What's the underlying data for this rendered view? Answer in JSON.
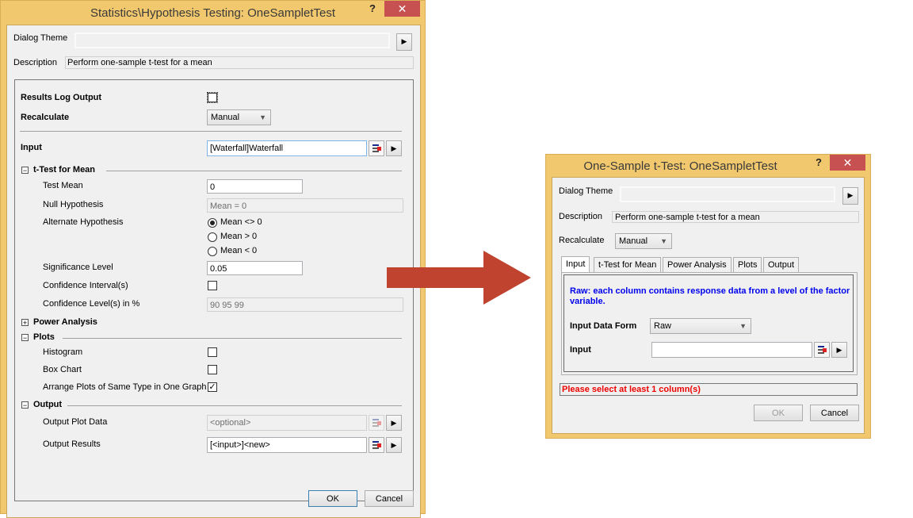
{
  "left": {
    "title": "Statistics\\Hypothesis Testing: OneSampletTest",
    "help": "?",
    "close": "✕",
    "dialog_theme_label": "Dialog Theme",
    "dialog_theme_value": "",
    "description_label": "Description",
    "description": "Perform one-sample t-test for a mean",
    "results_log_label": "Results Log Output",
    "results_log_checked": false,
    "recalculate_label": "Recalculate",
    "recalculate_value": "Manual",
    "input_label": "Input",
    "input_value": "[Waterfall]Waterfall",
    "ttest_section": "t-Test for Mean",
    "test_mean_label": "Test Mean",
    "test_mean": "0",
    "null_label": "Null Hypothesis",
    "null_value": "Mean = 0",
    "alt_label": "Alternate Hypothesis",
    "alt_options": [
      "Mean <> 0",
      "Mean > 0",
      "Mean < 0"
    ],
    "alt_selected": 0,
    "sig_label": "Significance Level",
    "sig_value": "0.05",
    "ci_label": "Confidence Interval(s)",
    "ci_checked": false,
    "cl_label": "Confidence Level(s) in %",
    "cl_value": "90 95 99",
    "power_section": "Power Analysis",
    "plots_section": "Plots",
    "histogram_label": "Histogram",
    "histogram_checked": false,
    "boxchart_label": "Box Chart",
    "boxchart_checked": false,
    "arrange_label": "Arrange Plots of Same Type in One Graph",
    "arrange_checked": true,
    "output_section": "Output",
    "output_plot_label": "Output Plot Data",
    "output_plot_value": "<optional>",
    "output_results_label": "Output Results",
    "output_results_value": "[<input>]<new>",
    "ok": "OK",
    "cancel": "Cancel",
    "expand_minus": "−",
    "expand_plus": "+"
  },
  "right": {
    "title": "One-Sample t-Test: OneSampletTest",
    "help": "?",
    "close": "✕",
    "dialog_theme_label": "Dialog Theme",
    "description_label": "Description",
    "description": "Perform one-sample t-test for a mean",
    "recalculate_label": "Recalculate",
    "recalculate_value": "Manual",
    "tabs": [
      "Input",
      "t-Test for Mean",
      "Power Analysis",
      "Plots",
      "Output"
    ],
    "active_tab": 0,
    "info": "Raw: each column contains response data from a level of the factor variable.",
    "input_form_label": "Input Data Form",
    "input_form_value": "Raw",
    "input_label": "Input",
    "input_value": "",
    "error": "Please select at least 1 column(s)",
    "ok": "OK",
    "cancel": "Cancel"
  },
  "colors": {
    "titlebar": "#f2c86e",
    "close": "#c75050",
    "arrow": "#c0432f",
    "info": "#0000ee",
    "error": "#ee0000"
  }
}
